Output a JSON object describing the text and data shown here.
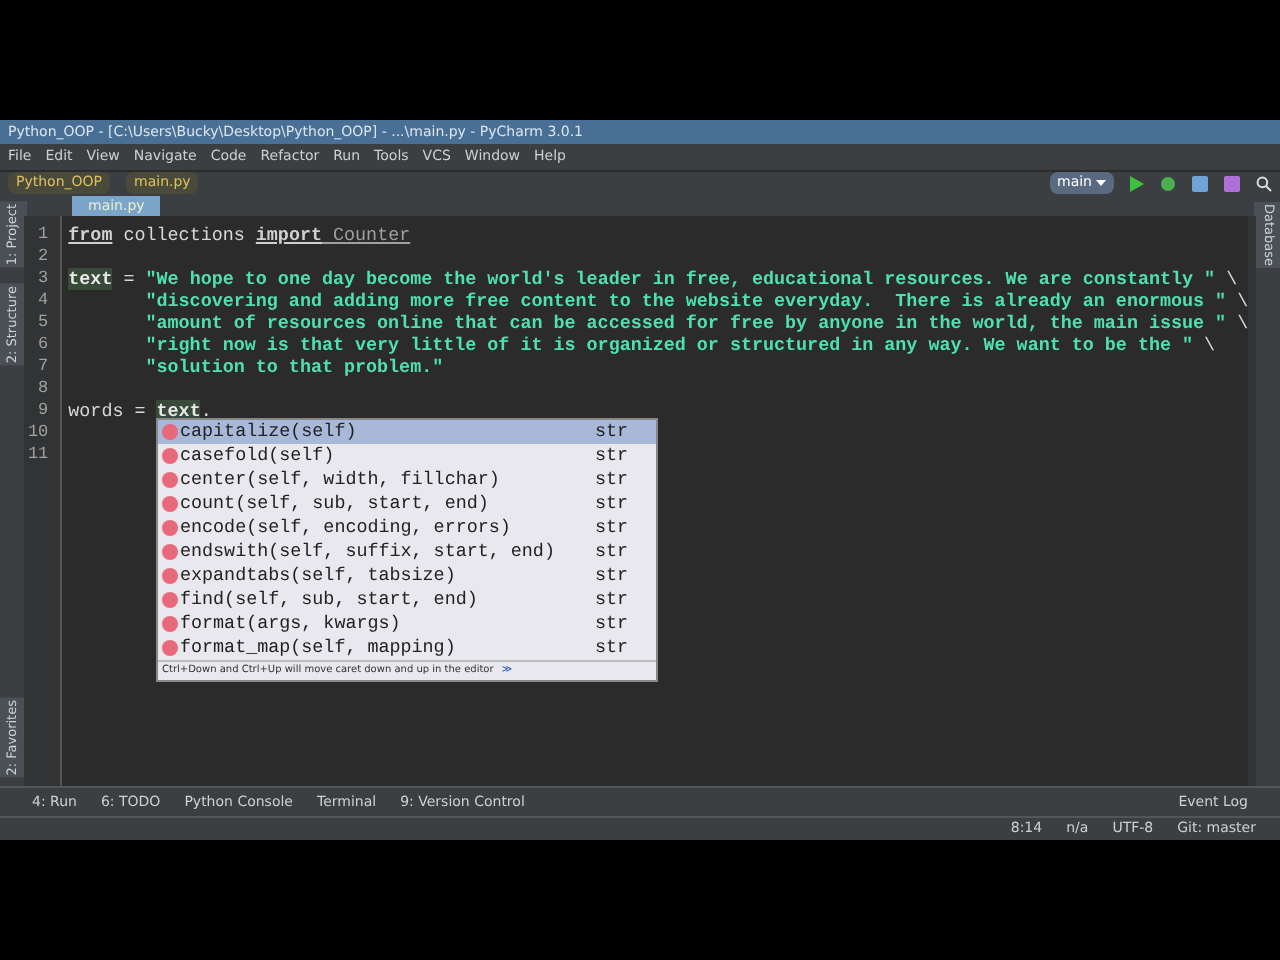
{
  "window": {
    "title": "Python_OOP - [C:\\Users\\Bucky\\Desktop\\Python_OOP] - ...\\main.py - PyCharm 3.0.1"
  },
  "menu": [
    "File",
    "Edit",
    "View",
    "Navigate",
    "Code",
    "Refactor",
    "Run",
    "Tools",
    "VCS",
    "Window",
    "Help"
  ],
  "breadcrumbs": [
    "Python_OOP",
    "main.py"
  ],
  "run_config": "main",
  "tabs": [
    {
      "label": "main.py",
      "selected": true
    }
  ],
  "left_strip": [
    "1: Project",
    "2: Structure",
    "2: Favorites"
  ],
  "right_strip": [
    "Database"
  ],
  "code": [
    {
      "number": "1",
      "tokens": [
        {
          "text": "from",
          "kind": "keyword"
        },
        {
          "text": " collections ",
          "kind": "plain"
        },
        {
          "text": "import",
          "kind": "keyword"
        },
        {
          "text": " Counter",
          "kind": "unused"
        }
      ]
    },
    {
      "number": "2"
    },
    {
      "number": "3",
      "tokens": [
        {
          "text": "text",
          "kind": "highlight"
        },
        {
          "text": " = ",
          "kind": "plain"
        },
        {
          "text": "\"We hope to one day become the world's leader in free, educational resources. We are constantly \"",
          "kind": "string"
        },
        {
          "text": " \\",
          "kind": "plain"
        }
      ]
    },
    {
      "number": "4",
      "continuation": true,
      "tokens": [
        {
          "text": "\"discovering and adding more free content to the website everyday.  There is already an enormous \"",
          "kind": "string"
        },
        {
          "text": " \\",
          "kind": "plain"
        }
      ]
    },
    {
      "number": "5",
      "continuation": true,
      "tokens": [
        {
          "text": "\"amount of resources online that can be accessed for free by anyone in the world, the main issue \"",
          "kind": "string"
        },
        {
          "text": " \\",
          "kind": "plain"
        }
      ]
    },
    {
      "number": "6",
      "continuation": true,
      "tokens": [
        {
          "text": "\"right now is that very little of it is organized or structured in any way. We want to be the \"",
          "kind": "string"
        },
        {
          "text": " \\",
          "kind": "plain"
        }
      ]
    },
    {
      "number": "7",
      "continuation": true,
      "tokens": [
        {
          "text": "\"solution to that problem.\"",
          "kind": "string"
        }
      ]
    },
    {
      "number": "8"
    },
    {
      "number": "9",
      "tokens": [
        {
          "text": "words",
          "kind": "plain"
        },
        {
          "text": " = ",
          "kind": "plain"
        },
        {
          "text": "text",
          "kind": "highlight"
        },
        {
          "text": ".",
          "kind": "plain"
        }
      ]
    },
    {
      "number": "10"
    },
    {
      "number": "11"
    }
  ],
  "completion": {
    "items": [
      {
        "label": "capitalize(self)",
        "type": "str",
        "selected": true
      },
      {
        "label": "casefold(self)",
        "type": "str",
        "selected": false
      },
      {
        "label": "center(self, width, fillchar)",
        "type": "str",
        "selected": false
      },
      {
        "label": "count(self, sub, start, end)",
        "type": "str",
        "selected": false
      },
      {
        "label": "encode(self, encoding, errors)",
        "type": "str",
        "selected": false
      },
      {
        "label": "endswith(self, suffix, start, end)",
        "type": "str",
        "selected": false
      },
      {
        "label": "expandtabs(self, tabsize)",
        "type": "str",
        "selected": false
      },
      {
        "label": "find(self, sub, start, end)",
        "type": "str",
        "selected": false
      },
      {
        "label": "format(args, kwargs)",
        "type": "str",
        "selected": false
      },
      {
        "label": "format_map(self, mapping)",
        "type": "str",
        "selected": false
      }
    ],
    "hint": "Ctrl+Down and Ctrl+Up will move caret down and up in the editor",
    "hint_link": "≫"
  },
  "tool_buttons": [
    "4: Run",
    "6: TODO",
    "Python Console",
    "Terminal",
    "9: Version Control"
  ],
  "event_log": "Event Log",
  "status_bar": [
    "8:14",
    "n/a",
    "UTF-8",
    "Git: master"
  ]
}
